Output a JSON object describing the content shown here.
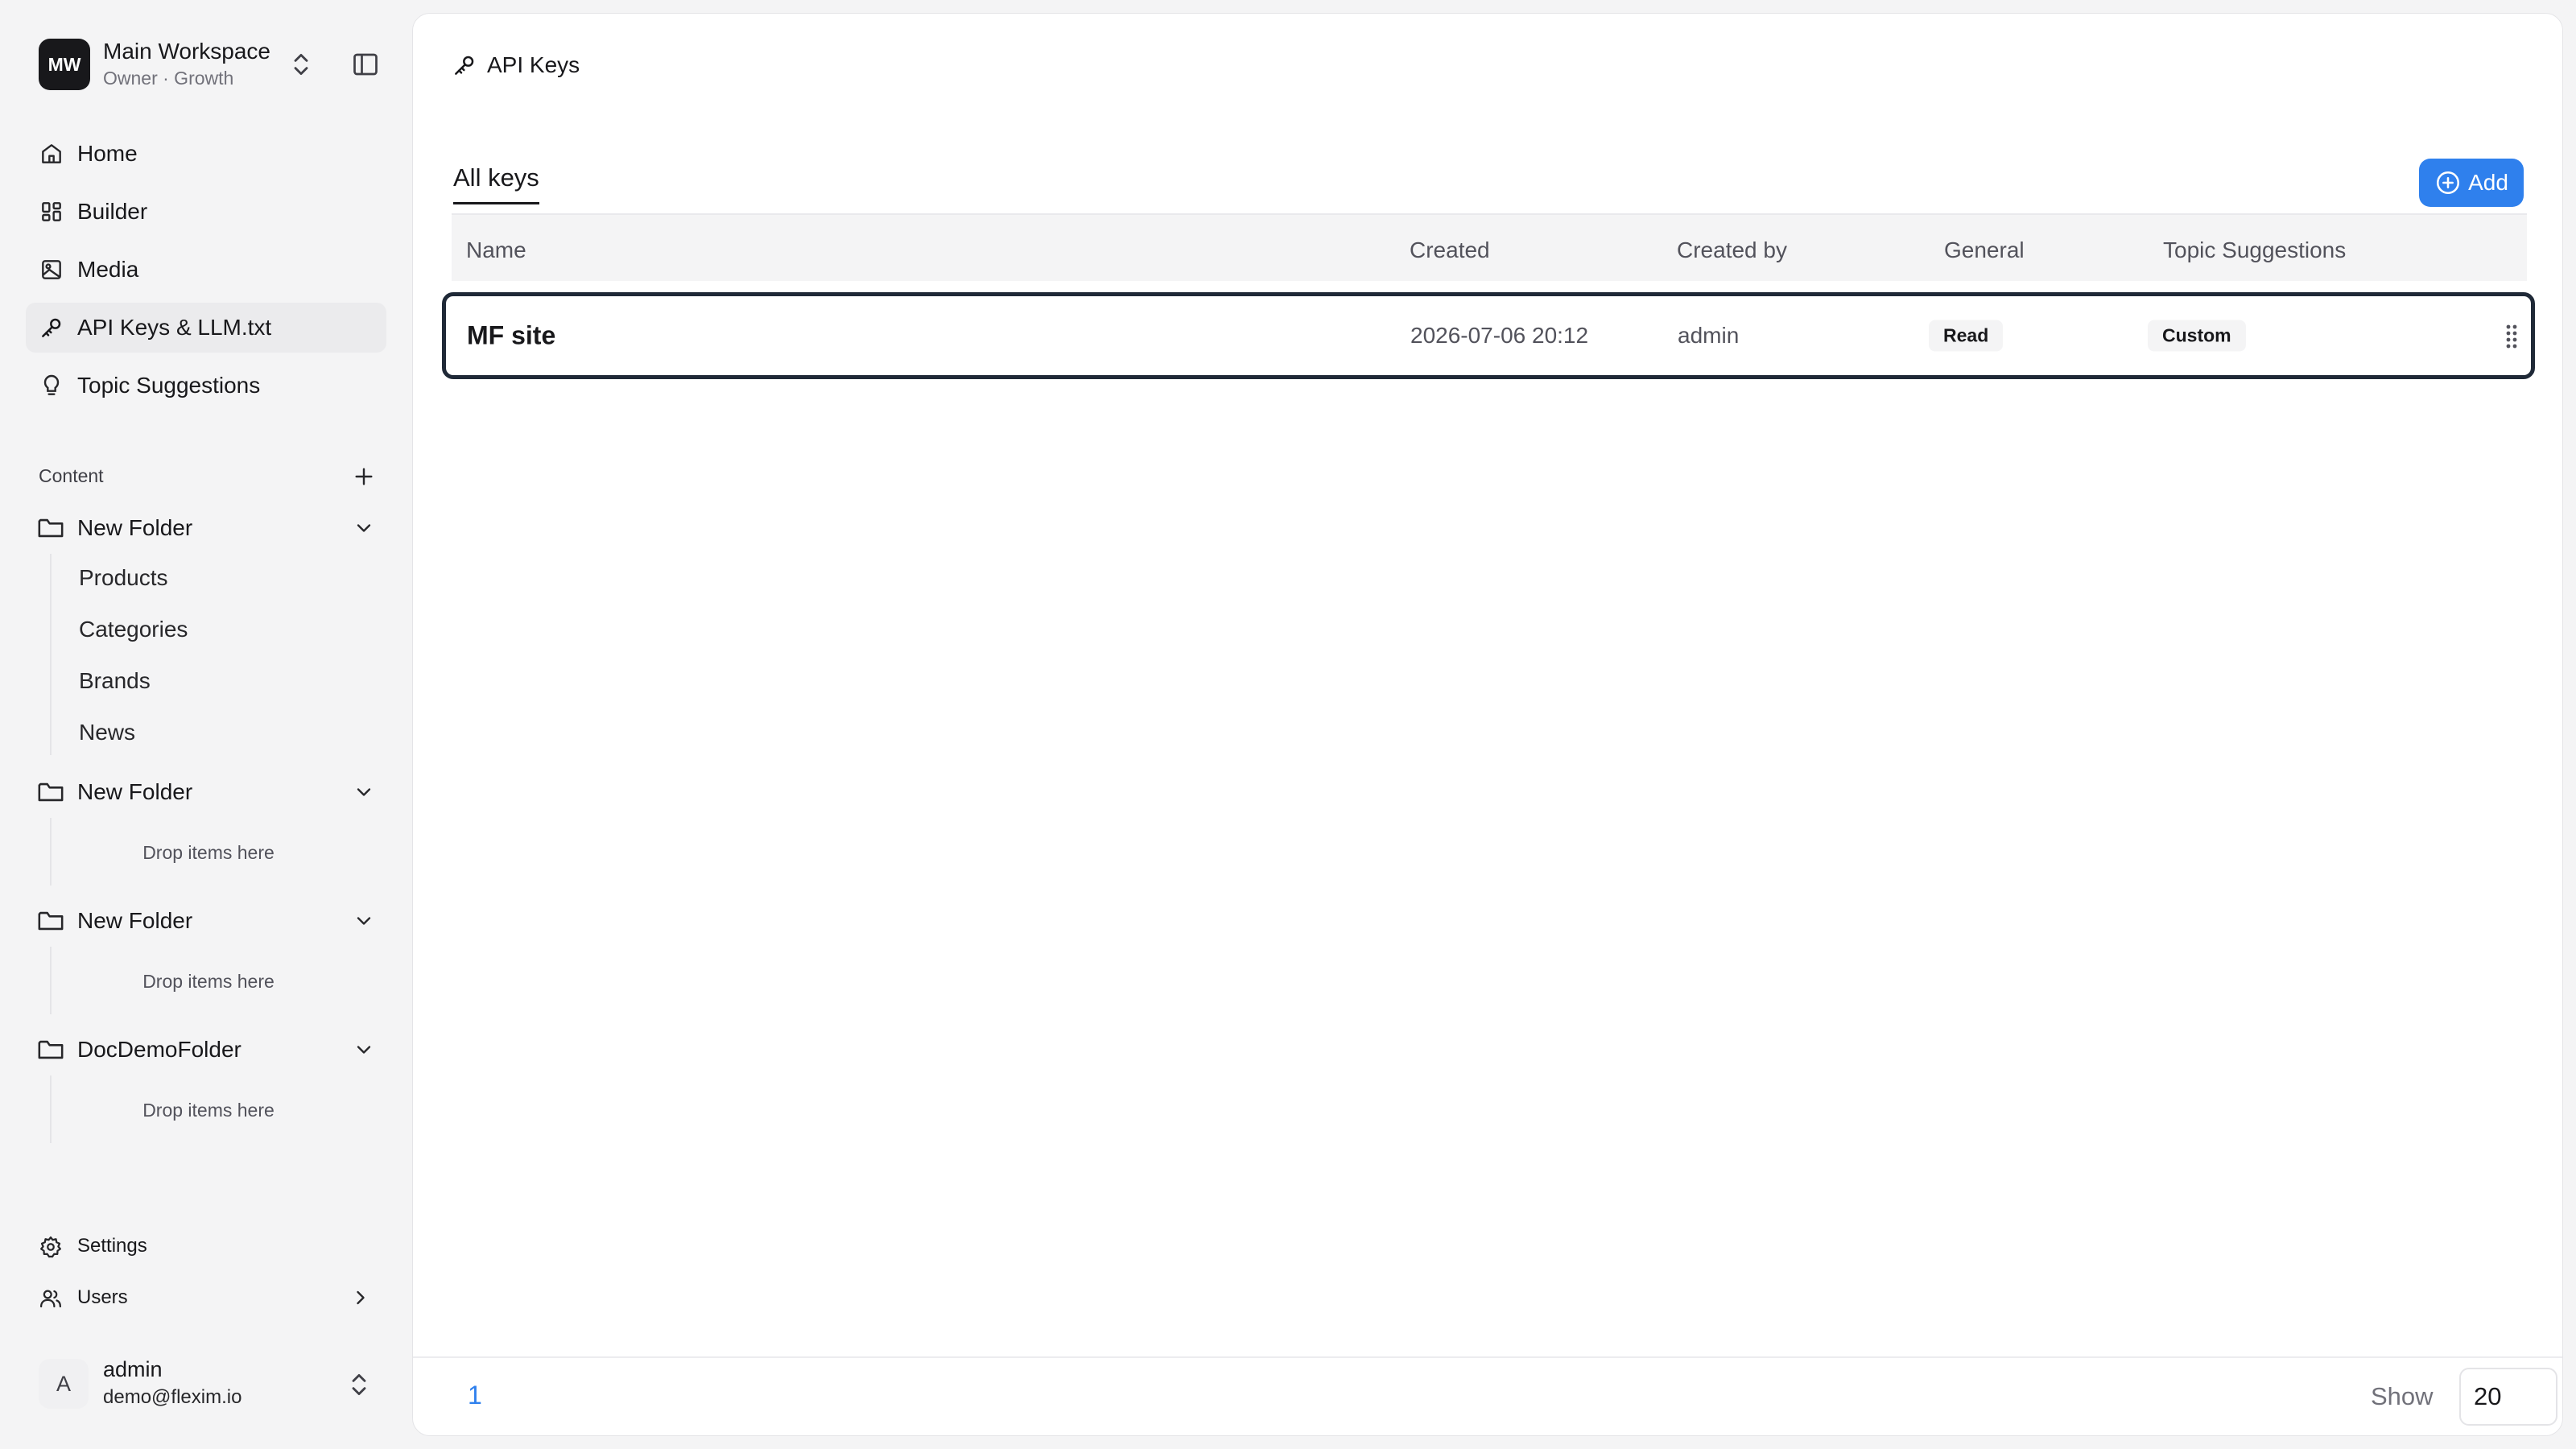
{
  "workspace": {
    "initials": "MW",
    "name": "Main Workspace",
    "subtitle": "Owner · Growth"
  },
  "nav": {
    "items": [
      {
        "label": "Home",
        "icon": "home-icon"
      },
      {
        "label": "Builder",
        "icon": "grid-icon"
      },
      {
        "label": "Media",
        "icon": "image-icon"
      },
      {
        "label": "API Keys & LLM.txt",
        "icon": "key-icon",
        "active": true
      },
      {
        "label": "Topic Suggestions",
        "icon": "lightbulb-icon"
      }
    ]
  },
  "content": {
    "section_label": "Content",
    "folders": [
      {
        "name": "New Folder",
        "children": [
          "Products",
          "Categories",
          "Brands",
          "News"
        ]
      },
      {
        "name": "New Folder",
        "drop_text": "Drop items here"
      },
      {
        "name": "New Folder",
        "drop_text": "Drop items here"
      },
      {
        "name": "DocDemoFolder",
        "drop_text": "Drop items here"
      }
    ]
  },
  "bottom_nav": {
    "settings": "Settings",
    "users": "Users"
  },
  "user": {
    "initial": "A",
    "name": "admin",
    "email": "demo@flexim.io"
  },
  "page": {
    "title": "API Keys",
    "tab": "All keys",
    "add_label": "Add"
  },
  "table": {
    "columns": [
      "Name",
      "Created",
      "Created by",
      "General",
      "Topic Suggestions"
    ],
    "rows": [
      {
        "name": "MF site",
        "created": "2026-07-06 20:12",
        "created_by": "admin",
        "general": "Read",
        "topic_suggestions": "Custom"
      }
    ]
  },
  "pagination": {
    "current_page": "1",
    "show_label": "Show",
    "page_size": "20"
  },
  "colors": {
    "accent": "#2f80ed",
    "workspace_avatar": "#18181b",
    "selected_row_border": "#1f2937"
  }
}
